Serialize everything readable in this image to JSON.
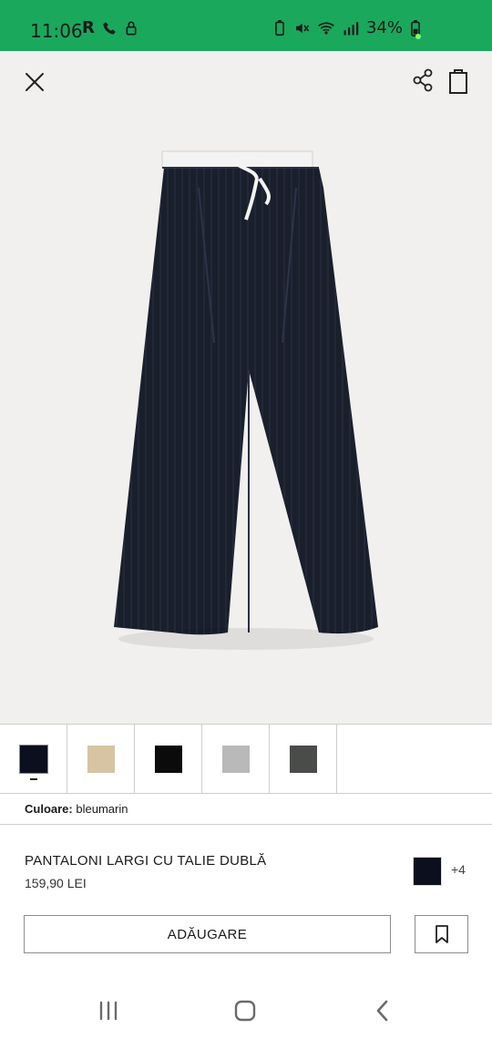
{
  "status_bar": {
    "time": "11:06",
    "battery": "34%",
    "background": "#1aa85c"
  },
  "top_actions": {
    "close_icon": "close-icon",
    "share_icon": "share-icon",
    "bag_icon": "shopping-bag-icon"
  },
  "product": {
    "image_icon": "wide-leg-trousers-icon",
    "title": "PANTALONI LARGI CU TALIE DUBLĂ",
    "price": "159,90 LEI",
    "selected_color_label": "Culoare:",
    "selected_color_value": "bleumarin",
    "more_colors": "+4",
    "mini_swatch_color": "#0c0f1e"
  },
  "swatches": [
    {
      "name": "bleumarin",
      "color": "#0c0f1e",
      "selected": true
    },
    {
      "name": "bej",
      "color": "#d7c4a3",
      "selected": false
    },
    {
      "name": "negru",
      "color": "#0b0b0b",
      "selected": false
    },
    {
      "name": "gri",
      "color": "#b9b9b9",
      "selected": false
    },
    {
      "name": "kaki",
      "color": "#494c48",
      "selected": false
    }
  ],
  "actions": {
    "add_label": "ADĂUGARE",
    "bookmark_icon": "bookmark-icon"
  },
  "nav": {
    "recent_icon": "recent-apps-icon",
    "home_icon": "home-icon",
    "back_icon": "back-icon"
  }
}
